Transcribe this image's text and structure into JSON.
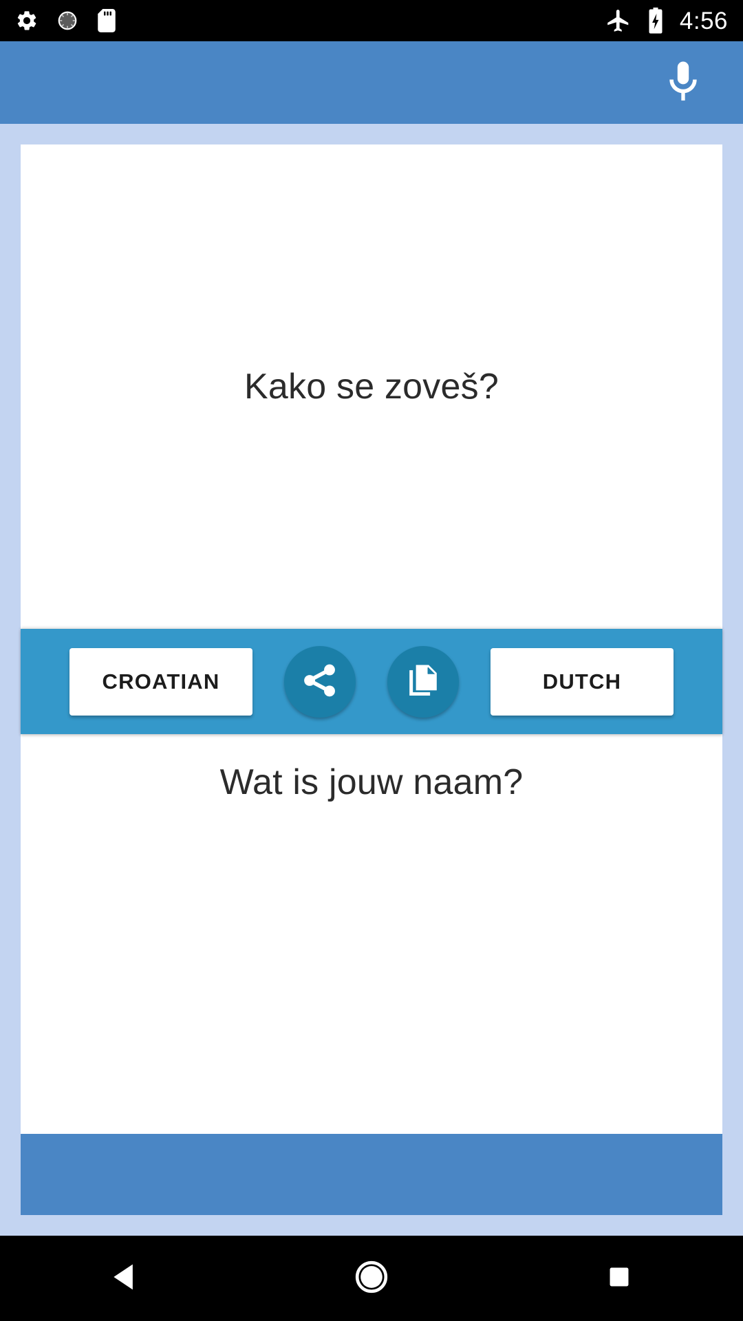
{
  "status_bar": {
    "left_icons": [
      {
        "name": "settings-gear-icon",
        "label": "settings"
      },
      {
        "name": "sync-spinner-icon",
        "label": "sync"
      },
      {
        "name": "sd-card-icon",
        "label": "sd card"
      }
    ],
    "right_icons": [
      {
        "name": "airplane-mode-icon",
        "label": "airplane mode"
      },
      {
        "name": "battery-charging-icon",
        "label": "battery charging"
      }
    ],
    "time": "4:56"
  },
  "header": {
    "mic_icon": "microphone-icon",
    "background_color": "#4a86c5"
  },
  "translation": {
    "source_text": "Kako se zoveš?",
    "target_text": "Wat is jouw naam?"
  },
  "controls": {
    "source_language": "CROATIAN",
    "target_language": "DUTCH",
    "share_icon": "share-icon",
    "copy_icon": "copy-icon",
    "bar_color": "#3498ca",
    "round_button_color": "#1b7fa8"
  },
  "nav_bar": {
    "back": "back-icon",
    "home": "home-icon",
    "recents": "recents-icon"
  }
}
